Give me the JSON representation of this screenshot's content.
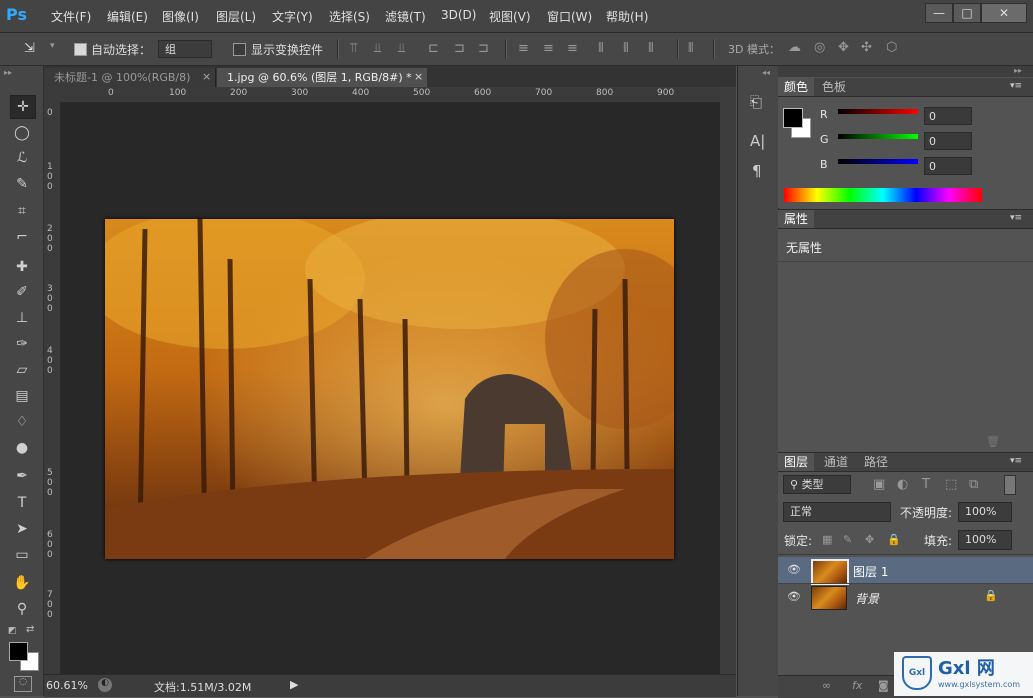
{
  "app": {
    "logo": "Ps"
  },
  "menu": [
    "文件(F)",
    "编辑(E)",
    "图像(I)",
    "图层(L)",
    "文字(Y)",
    "选择(S)",
    "滤镜(T)",
    "3D(D)",
    "视图(V)",
    "窗口(W)",
    "帮助(H)"
  ],
  "window_controls": {
    "minimize": "—",
    "maximize": "□",
    "close": "✕"
  },
  "options": {
    "auto_select_label": "自动选择：",
    "auto_select_value": "组",
    "show_transform_label": "显示变换控件",
    "mode_3d_label": "3D 模式："
  },
  "tabs": [
    {
      "title": "未标题-1 @ 100%(RGB/8)",
      "close": "×"
    },
    {
      "title": "1.jpg @ 60.6% (图层 1, RGB/8#) *",
      "close": "×"
    }
  ],
  "ruler_top": [
    "0",
    "100",
    "200",
    "300",
    "400",
    "500",
    "600",
    "700",
    "800",
    "900"
  ],
  "ruler_left": [
    "0",
    "100",
    "200",
    "300",
    "400",
    "500",
    "600",
    "700"
  ],
  "status": {
    "zoom": "60.61%",
    "doc": "文档:1.51M/3.02M"
  },
  "color_panel": {
    "tabs": [
      "颜色",
      "色板"
    ],
    "channels": [
      {
        "label": "R",
        "value": "0",
        "color": "#ff0000"
      },
      {
        "label": "G",
        "value": "0",
        "color": "#00ff00"
      },
      {
        "label": "B",
        "value": "0",
        "color": "#0000ff"
      }
    ]
  },
  "properties_panel": {
    "tab": "属性",
    "empty_text": "无属性"
  },
  "layers_panel": {
    "tabs": [
      "图层",
      "通道",
      "路径"
    ],
    "filter_kind": "类型",
    "blend_mode": "正常",
    "opacity_label": "不透明度:",
    "opacity_value": "100%",
    "lock_label": "锁定:",
    "fill_label": "填充:",
    "fill_value": "100%",
    "layers": [
      {
        "name": "图层 1",
        "selected": true
      },
      {
        "name": "背景",
        "selected": false,
        "locked": true
      }
    ]
  },
  "watermark": {
    "text": "Gxl 网",
    "url": "www.gxlsystem.com"
  },
  "colors": {
    "accent": "#31a8ff",
    "selected_layer": "#5a6a80"
  }
}
